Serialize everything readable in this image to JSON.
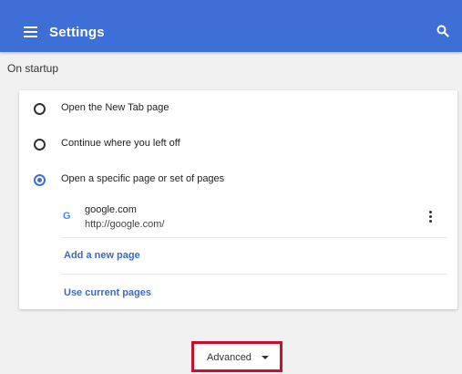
{
  "header": {
    "title": "Settings",
    "menu_icon": "hamburger-menu-icon",
    "search_icon": "search-icon",
    "color": "#3d6fd6"
  },
  "startup": {
    "heading": "On startup",
    "options": [
      {
        "label": "Open the New Tab page",
        "checked": false
      },
      {
        "label": "Continue where you left off",
        "checked": false
      },
      {
        "label": "Open a specific page or set of pages",
        "checked": true
      }
    ],
    "pages": [
      {
        "name": "google.com",
        "url": "http://google.com/",
        "icon": "google-g-icon"
      }
    ],
    "add_page_label": "Add a new page",
    "use_current_label": "Use current pages"
  },
  "advanced": {
    "label": "Advanced",
    "highlight_color": "#c8102e"
  },
  "accent_color": "#3f6fd0"
}
